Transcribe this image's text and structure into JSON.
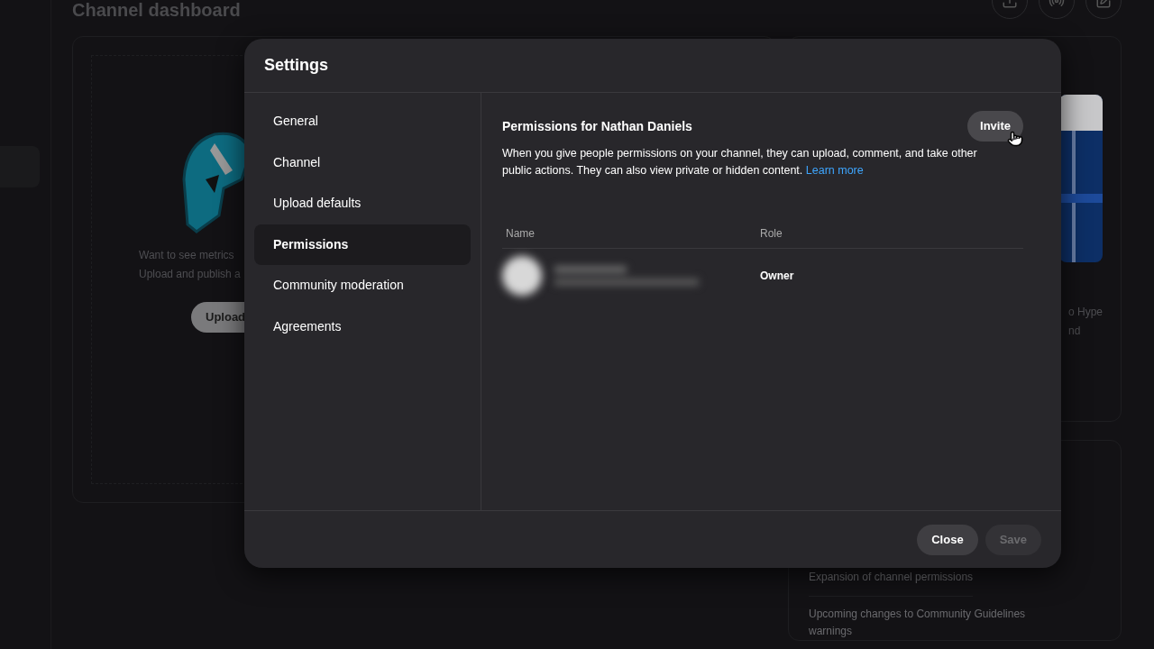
{
  "background": {
    "page_title": "Channel dashboard",
    "card_text": [
      "Want to see metrics",
      "Upload and publish a"
    ],
    "upload_button": "Upload",
    "side_text": [
      "o Hype",
      "nd"
    ],
    "news": [
      "Expansion of channel permissions",
      "Upcoming changes to Community Guidelines warnings"
    ]
  },
  "dialog": {
    "title": "Settings",
    "nav": [
      {
        "label": "General",
        "selected": false
      },
      {
        "label": "Channel",
        "selected": false
      },
      {
        "label": "Upload defaults",
        "selected": false
      },
      {
        "label": "Permissions",
        "selected": true
      },
      {
        "label": "Community moderation",
        "selected": false
      },
      {
        "label": "Agreements",
        "selected": false
      }
    ],
    "heading": "Permissions for Nathan Daniels",
    "invite_button": "Invite",
    "description": "When you give people permissions on your channel, they can upload, comment, and take other public actions. They can also view private or hidden content.",
    "link": "Learn more",
    "table": {
      "columns": [
        "Name",
        "Role"
      ],
      "rows": [
        {
          "role": "Owner"
        }
      ]
    },
    "buttons": [
      {
        "label": "Close",
        "disabled": false
      },
      {
        "label": "Save",
        "disabled": true
      }
    ]
  }
}
